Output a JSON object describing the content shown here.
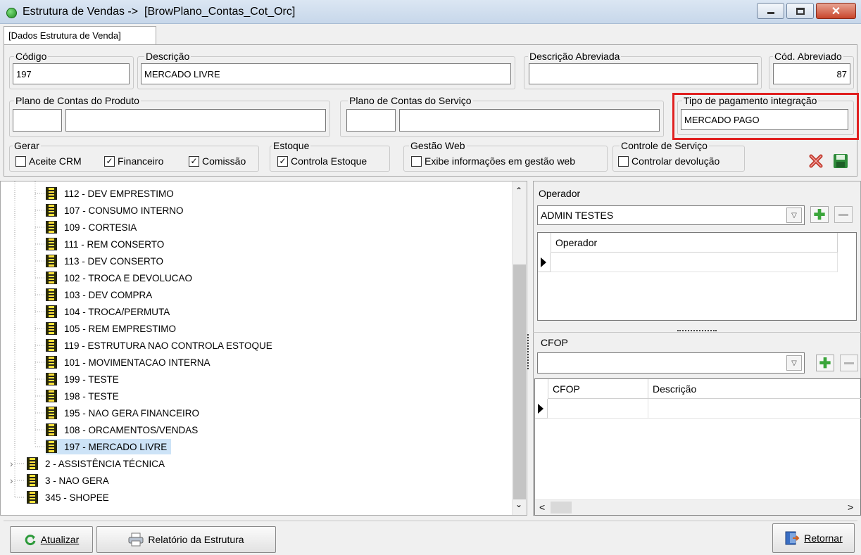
{
  "window": {
    "title": "Estrutura de Vendas ->  [BrowPlano_Contas_Cot_Orc]",
    "minimize": "–",
    "maximize": "□",
    "close": "✕"
  },
  "tab": {
    "label": "[Dados Estrutura de Venda]"
  },
  "form": {
    "codigo": {
      "label": "Código",
      "value": "197"
    },
    "descricao": {
      "label": "Descrição",
      "value": "MERCADO LIVRE"
    },
    "descricao_abreviada": {
      "label": "Descrição Abreviada",
      "value": ""
    },
    "cod_abreviado": {
      "label": "Cód. Abreviado",
      "value": "87"
    },
    "plano_produto": {
      "label": "Plano de Contas do Produto",
      "code": "",
      "value": ""
    },
    "plano_servico": {
      "label": "Plano de Contas do Serviço",
      "code": "",
      "value": ""
    },
    "tipo_pagamento": {
      "label": "Tipo de pagamento integração",
      "value": "MERCADO PAGO",
      "highlight_color": "#e02020"
    },
    "gerar": {
      "label": "Gerar",
      "aceite_crm": "Aceite CRM",
      "financeiro": "Financeiro",
      "comissao": "Comissão"
    },
    "estoque": {
      "label": "Estoque",
      "controla": "Controla Estoque"
    },
    "gestao_web": {
      "label": "Gestão Web",
      "exibe": "Exibe informações em gestão web"
    },
    "controle_servico": {
      "label": "Controle de Serviço",
      "devolucao": "Controlar devolução"
    }
  },
  "tree": {
    "items": [
      "112 - DEV EMPRESTIMO",
      "107 - CONSUMO INTERNO",
      "109 - CORTESIA",
      "111 - REM CONSERTO",
      "113 - DEV CONSERTO",
      "102 - TROCA E DEVOLUCAO",
      "103 - DEV COMPRA",
      "104 - TROCA/PERMUTA",
      "105 - REM EMPRESTIMO",
      "119 - ESTRUTURA NAO CONTROLA ESTOQUE",
      "101 - MOVIMENTACAO INTERNA",
      "199 - TESTE",
      "198 - TESTE",
      "195 - NAO GERA FINANCEIRO",
      "108 - ORCAMENTOS/VENDAS",
      "197 - MERCADO LIVRE"
    ],
    "roots": [
      "2 - ASSISTÊNCIA TÉCNICA",
      "3 - NAO GERA",
      "345 - SHOPEE"
    ],
    "scroll_up": "⌃",
    "scroll_down": "⌄"
  },
  "operador": {
    "label": "Operador",
    "selected": "ADMIN TESTES",
    "grid_header": "Operador"
  },
  "cfop": {
    "label": "CFOP",
    "selected": "",
    "col_cfop": "CFOP",
    "col_descricao": "Descrição",
    "scroll_left": "<",
    "scroll_right": ">"
  },
  "footer": {
    "atualizar": "Atualizar",
    "relatorio": "Relatório da Estrutura",
    "retornar": "Retornar"
  }
}
